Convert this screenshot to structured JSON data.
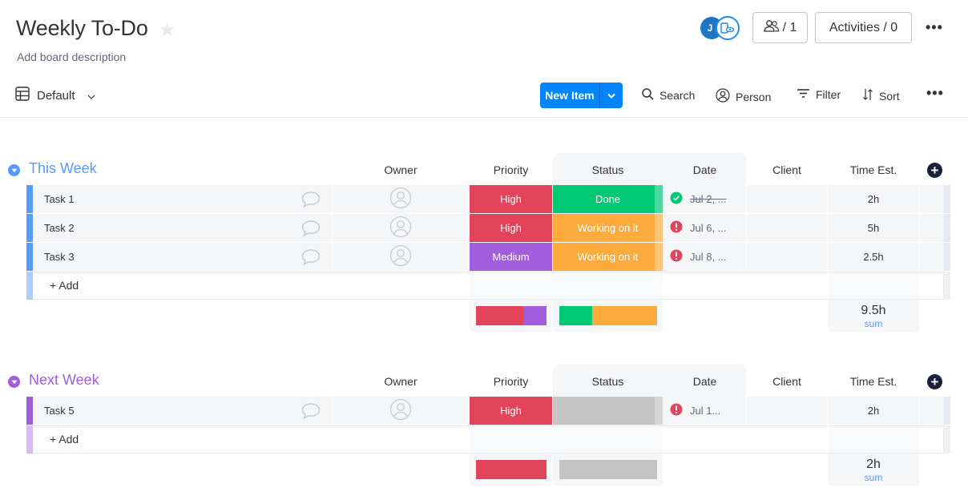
{
  "board": {
    "title": "Weekly To-Do",
    "description": "Add board description"
  },
  "header": {
    "avatar_initial": "J",
    "members_count": "/ 1",
    "activities_label": "Activities / 0"
  },
  "toolbar": {
    "view_label": "Default",
    "new_item_label": "New Item",
    "search_label": "Search",
    "person_label": "Person",
    "filter_label": "Filter",
    "sort_label": "Sort"
  },
  "columns": {
    "owner": "Owner",
    "priority": "Priority",
    "status": "Status",
    "date": "Date",
    "client": "Client",
    "time": "Time Est."
  },
  "colors": {
    "high": "#e2445c",
    "medium": "#a25ddc",
    "done": "#00c875",
    "working": "#fdab3d",
    "empty": "#c4c4c4",
    "group1": "#579bfc",
    "group2": "#a25ddc"
  },
  "groups": [
    {
      "title": "This Week",
      "color": "#579bfc",
      "add_color": "#aecdfc",
      "add_label": "+ Add",
      "rows": [
        {
          "name": "Task 1",
          "priority": "High",
          "priority_color": "#e2445c",
          "status": "Done",
          "status_color": "#00c875",
          "date": "Jul 2, ...",
          "date_state": "done",
          "client": "",
          "time": "2h"
        },
        {
          "name": "Task 2",
          "priority": "High",
          "priority_color": "#e2445c",
          "status": "Working on it",
          "status_color": "#fdab3d",
          "date": "Jul 6, ...",
          "date_state": "overdue",
          "client": "",
          "time": "5h"
        },
        {
          "name": "Task 3",
          "priority": "Medium",
          "priority_color": "#a25ddc",
          "status": "Working on it",
          "status_color": "#fdab3d",
          "date": "Jul 8, ...",
          "date_state": "overdue",
          "client": "",
          "time": "2.5h"
        }
      ],
      "summary": {
        "priority_dist": [
          {
            "label": "High",
            "fraction": 0.667,
            "color": "#e2445c"
          },
          {
            "label": "Medium",
            "fraction": 0.333,
            "color": "#a25ddc"
          }
        ],
        "status_dist": [
          {
            "label": "Done",
            "fraction": 0.333,
            "color": "#00c875"
          },
          {
            "label": "Working on it",
            "fraction": 0.667,
            "color": "#fdab3d"
          }
        ],
        "time_total": "9.5h",
        "time_label": "sum"
      }
    },
    {
      "title": "Next Week",
      "color": "#a25ddc",
      "add_color": "#d9b8f3",
      "add_label": "+ Add",
      "rows": [
        {
          "name": "Task 5",
          "priority": "High",
          "priority_color": "#e2445c",
          "status": "",
          "status_color": "#c4c4c4",
          "date": "Jul 1...",
          "date_state": "overdue",
          "client": "",
          "time": "2h"
        }
      ],
      "summary": {
        "priority_dist": [
          {
            "label": "High",
            "fraction": 1.0,
            "color": "#e2445c"
          }
        ],
        "status_dist": [
          {
            "label": "Empty",
            "fraction": 1.0,
            "color": "#c4c4c4"
          }
        ],
        "time_total": "2h",
        "time_label": "sum"
      }
    }
  ]
}
